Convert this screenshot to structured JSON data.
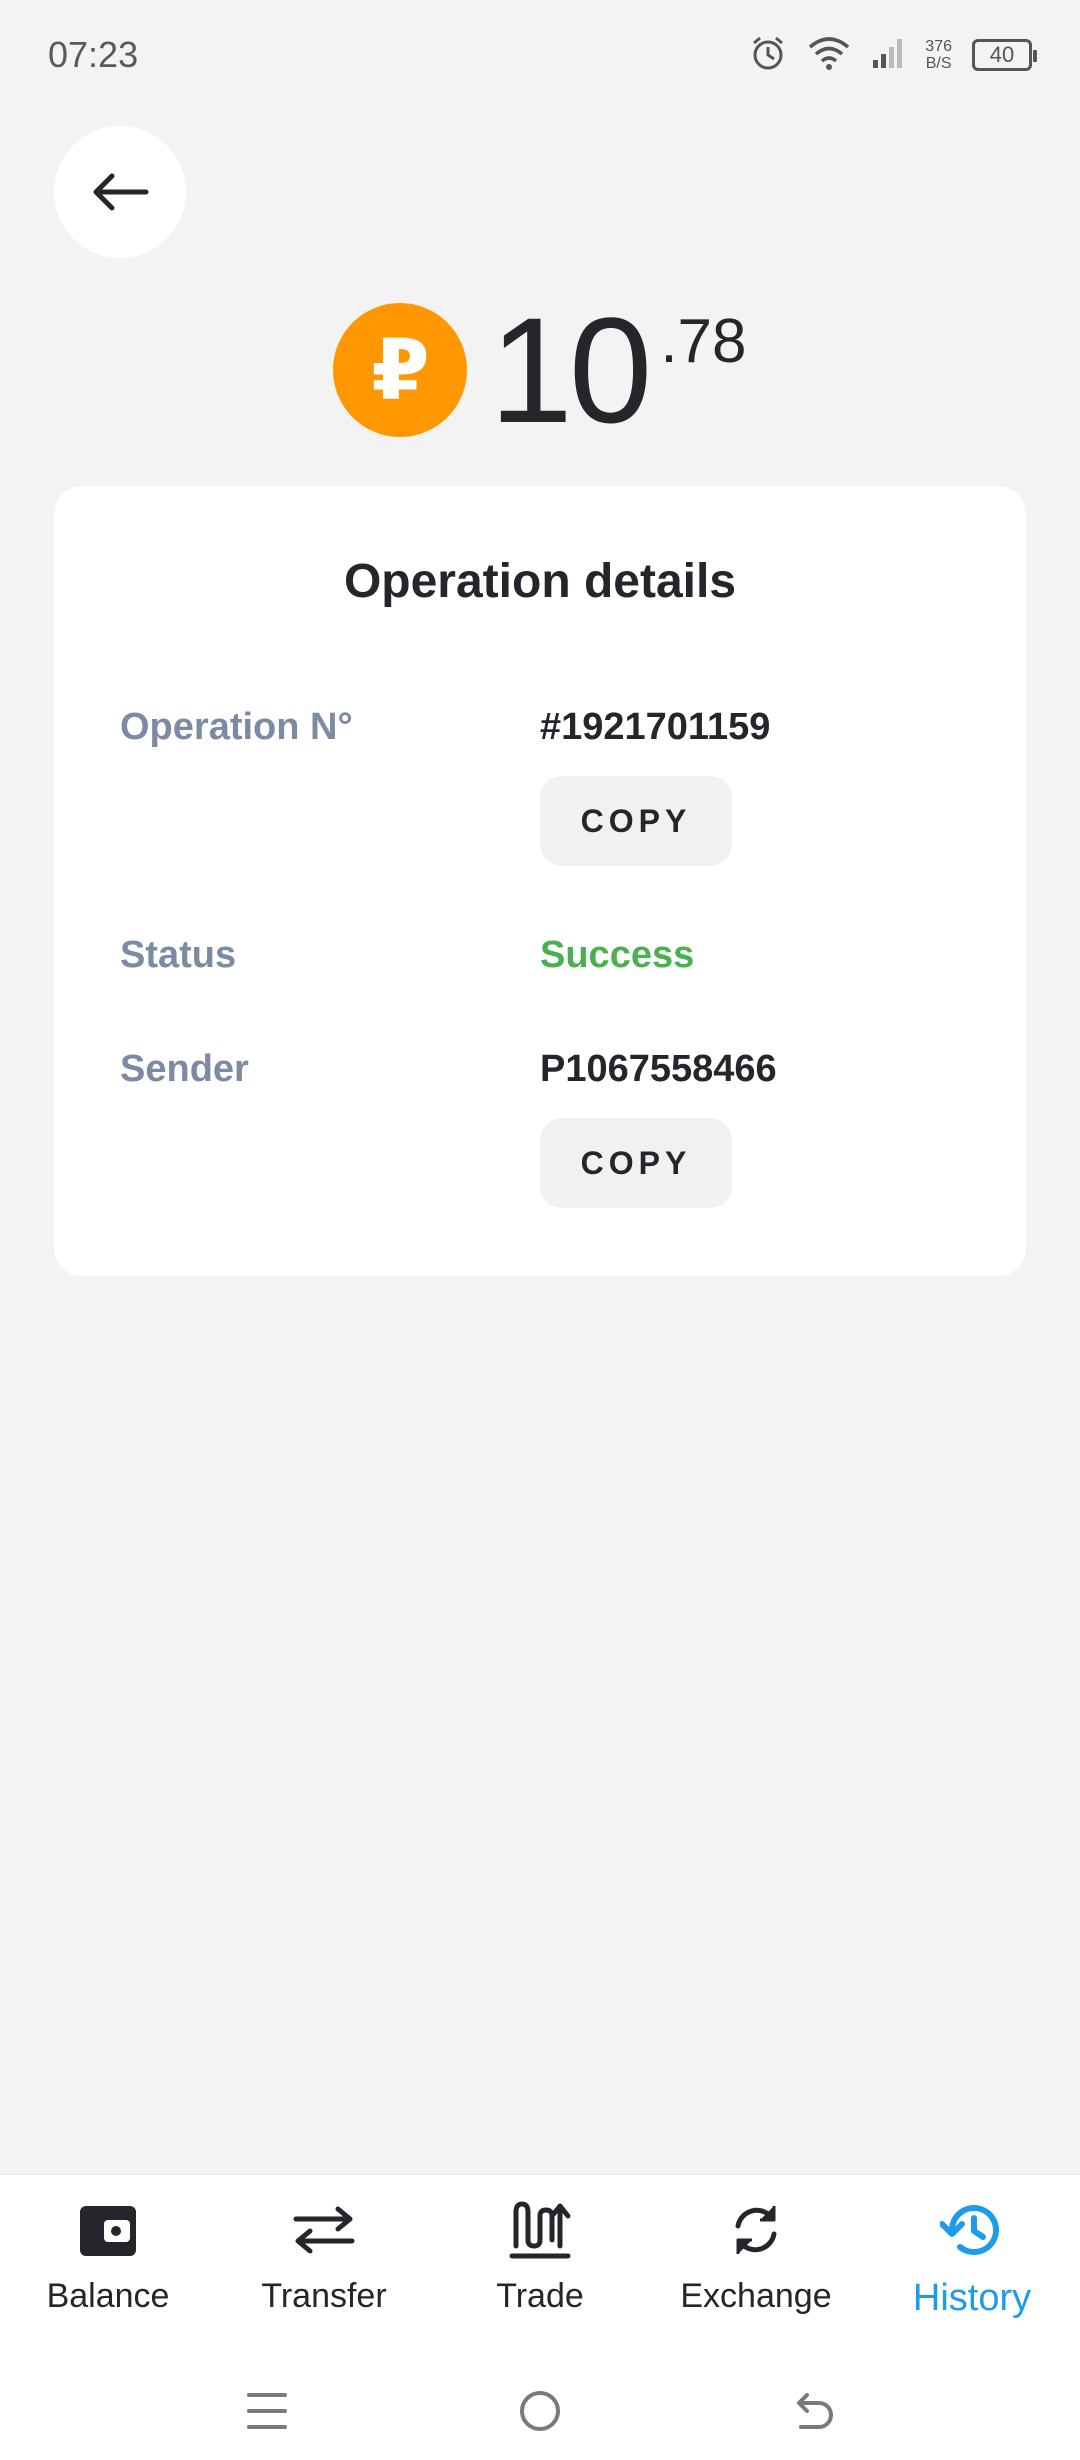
{
  "status_bar": {
    "time": "07:23",
    "net_speed_value": "376",
    "net_speed_unit": "B/S",
    "battery": "40"
  },
  "amount": {
    "currency_symbol": "₽",
    "integer": "10",
    "decimal": ".78"
  },
  "card": {
    "title": "Operation details",
    "rows": [
      {
        "label": "Operation N°",
        "value": "#1921701159",
        "copy_label": "COPY"
      },
      {
        "label": "Status",
        "value": "Success"
      },
      {
        "label": "Sender",
        "value": "P1067558466",
        "copy_label": "COPY"
      }
    ]
  },
  "bottom_nav": {
    "items": [
      {
        "label": "Balance",
        "icon": "wallet-icon"
      },
      {
        "label": "Transfer",
        "icon": "transfer-arrows-icon"
      },
      {
        "label": "Trade",
        "icon": "trade-chart-icon"
      },
      {
        "label": "Exchange",
        "icon": "exchange-cycle-icon"
      },
      {
        "label": "History",
        "icon": "history-clock-icon",
        "active": true
      }
    ]
  },
  "colors": {
    "background": "#f3f3f3",
    "coin": "#ff9800",
    "success": "#4caf50",
    "label": "#7d8aa3",
    "active_tab": "#1e9be9",
    "text": "#24262b"
  }
}
